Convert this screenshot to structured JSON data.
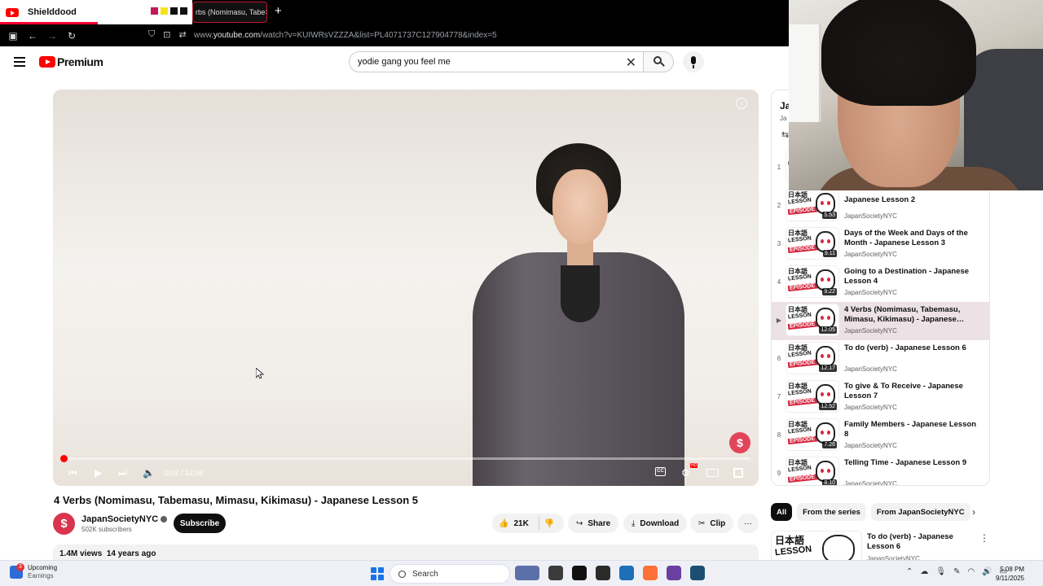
{
  "browser": {
    "active_tab_title": "Shielddood",
    "second_tab_title": "rbs (Nomimasu, Tabe",
    "second_tab_close": "×",
    "new_tab": "+",
    "url_prefix": "www.",
    "url_domain": "youtube.com",
    "url_path": "/watch?v=KUIWRsVZZZA&list=PL4071737C127904778&index=5",
    "swatch_colors": [
      "#c2185b",
      "#f5e31a",
      "#111111",
      "#111111"
    ]
  },
  "yt": {
    "logo_word": "Premium",
    "search_value": "yodie gang you feel me",
    "clear_glyph": "✕"
  },
  "player": {
    "time": "0:02 / 12:04",
    "progress_fraction": 0.003,
    "cc_label": "CC",
    "hd_label": "HD",
    "watermark_glyph": "$",
    "info_glyph": "i"
  },
  "video": {
    "title": "4 Verbs (Nomimasu, Tabemasu, Mimasu, Kikimasu) - Japanese Lesson 5",
    "channel": "JapanSocietyNYC",
    "subscribers": "502K subscribers",
    "subscribe_label": "Subscribe",
    "likes": "21K",
    "share_label": "Share",
    "download_label": "Download",
    "clip_label": "Clip",
    "more_label": "···",
    "views": "1.4M views",
    "age": "14 years ago"
  },
  "playlist": {
    "header": "Ja",
    "sub": "Ja",
    "items": [
      {
        "index": "1",
        "title": "",
        "channel": "",
        "duration": ""
      },
      {
        "index": "2",
        "title": "Japanese Lesson 2",
        "channel": "JapanSocietyNYC",
        "duration": "5:53",
        "ep": "2"
      },
      {
        "index": "3",
        "title": "Days of the Week and Days of the Month - Japanese Lesson 3",
        "channel": "JapanSocietyNYC",
        "duration": "9:11",
        "ep": "3"
      },
      {
        "index": "4",
        "title": "Going to a Destination - Japanese Lesson 4",
        "channel": "JapanSocietyNYC",
        "duration": "9:22",
        "ep": "4"
      },
      {
        "index": "▶",
        "title": "4 Verbs (Nomimasu, Tabemasu, Mimasu, Kikimasu) - Japanese…",
        "channel": "JapanSocietyNYC",
        "duration": "12:05",
        "ep": "5"
      },
      {
        "index": "6",
        "title": "To do (verb) - Japanese Lesson 6",
        "channel": "JapanSocietyNYC",
        "duration": "12:17",
        "ep": "6"
      },
      {
        "index": "7",
        "title": "To give & To Receive - Japanese Lesson 7",
        "channel": "JapanSocietyNYC",
        "duration": "12:52",
        "ep": "7"
      },
      {
        "index": "8",
        "title": "Family Members - Japanese Lesson 8",
        "channel": "JapanSocietyNYC",
        "duration": "7:26",
        "ep": "8"
      },
      {
        "index": "9",
        "title": "Telling Time - Japanese Lesson 9",
        "channel": "JapanSocietyNYC",
        "duration": "8:10",
        "ep": "9"
      }
    ],
    "thumb_jp": "日本語",
    "thumb_lesson": "LESSON",
    "thumb_episode": "EPISODE"
  },
  "chips": [
    "All",
    "From the series",
    "From JapanSocietyNYC"
  ],
  "chips_next": "›",
  "recommendation": {
    "title": "To do (verb) - Japanese Lesson 6",
    "channel": "JapanSocietyNYC",
    "thumb_jp": "日本語",
    "thumb_lesson": "LESSON",
    "more": "⋮"
  },
  "taskbar": {
    "weather_badge": "3",
    "weather_line1": "Upcoming",
    "weather_line2": "Earnings",
    "search_label": "Search",
    "time": "5:08 PM",
    "date": "9/11/2025",
    "app_colors": [
      "#5b6fa8",
      "#3b3b3b",
      "#111111",
      "#2b2b2b",
      "#1d6fb8",
      "#ff7139",
      "#6b3fa0",
      "#1b4f72"
    ]
  }
}
